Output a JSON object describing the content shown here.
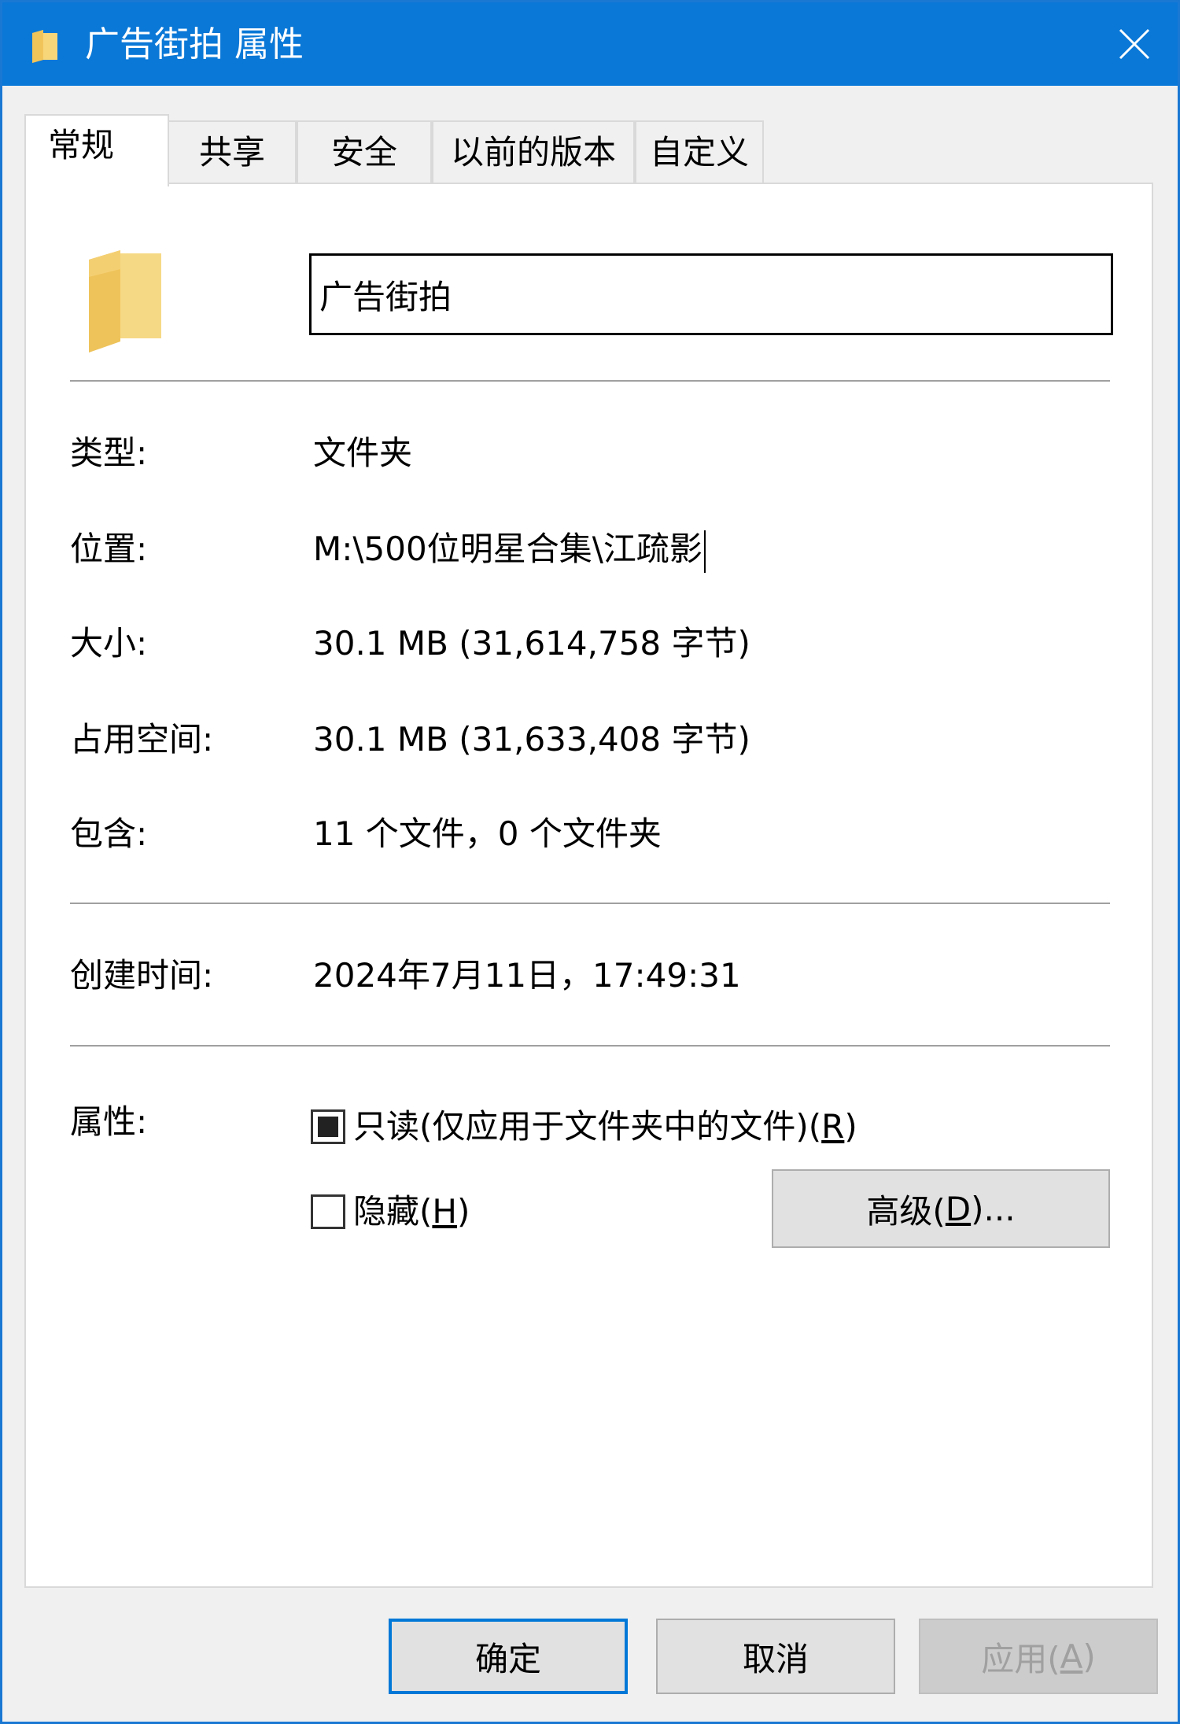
{
  "window": {
    "title": "广告街拍 属性",
    "accent_color": "#0a78d7",
    "title_icon": "folder-icon",
    "close_icon": "close-icon"
  },
  "tabs": [
    {
      "label": "常规",
      "active": true
    },
    {
      "label": "共享",
      "active": false
    },
    {
      "label": "安全",
      "active": false
    },
    {
      "label": "以前的版本",
      "active": false
    },
    {
      "label": "自定义",
      "active": false
    }
  ],
  "general": {
    "folder_icon": "folder-icon",
    "name_value": "广告街拍",
    "type_label": "类型:",
    "type_value": "文件夹",
    "location_label": "位置:",
    "location_value": "M:\\500位明星合集\\江疏影",
    "size_label": "大小:",
    "size_value": "30.1 MB (31,614,758 字节)",
    "disk_label": "占用空间:",
    "disk_value": "30.1 MB (31,633,408 字节)",
    "contains_label": "包含:",
    "contains_value": "11 个文件，0 个文件夹",
    "created_label": "创建时间:",
    "created_value": "2024年7月11日，17:49:31",
    "attributes_label": "属性:",
    "readonly_text": "只读(仅应用于文件夹中的文件)(",
    "readonly_key": "R",
    "readonly_state": "indeterminate",
    "hidden_text": "隐藏(",
    "hidden_key": "H",
    "hidden_checked": false,
    "advanced_text": "高级(",
    "advanced_key": "D",
    "advanced_suffix": ")..."
  },
  "buttons": {
    "ok_label": "确定",
    "cancel_label": "取消",
    "apply_text": "应用(",
    "apply_key": "A",
    "apply_disabled": true
  }
}
